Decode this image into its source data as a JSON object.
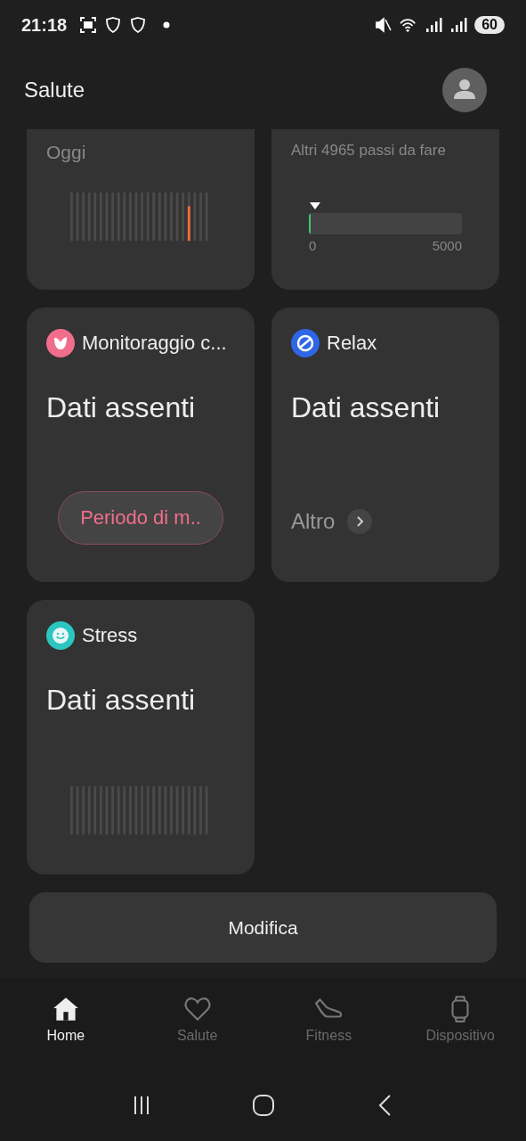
{
  "status_bar": {
    "time": "21:18",
    "battery": "60"
  },
  "header": {
    "title": "Salute"
  },
  "cards": [
    {
      "kind": "activity",
      "caption": "Oggi"
    },
    {
      "kind": "steps",
      "caption": "Altri 4965 passi da fare",
      "level": 0.007,
      "min": "0",
      "max": "5000"
    },
    {
      "kind": "cycle",
      "title": "Monitoraggio c...",
      "value": "Dati assenti",
      "button": "Periodo di m.."
    },
    {
      "kind": "relax",
      "title": "Relax",
      "value": "Dati assenti",
      "link": "Altro"
    },
    {
      "kind": "stress",
      "title": "Stress",
      "value": "Dati assenti"
    }
  ],
  "edit_button": "Modifica",
  "tabs": [
    {
      "label": "Home",
      "selected": true
    },
    {
      "label": "Salute",
      "selected": false
    },
    {
      "label": "Fitness",
      "selected": false
    },
    {
      "label": "Dispositivo",
      "selected": false
    }
  ]
}
